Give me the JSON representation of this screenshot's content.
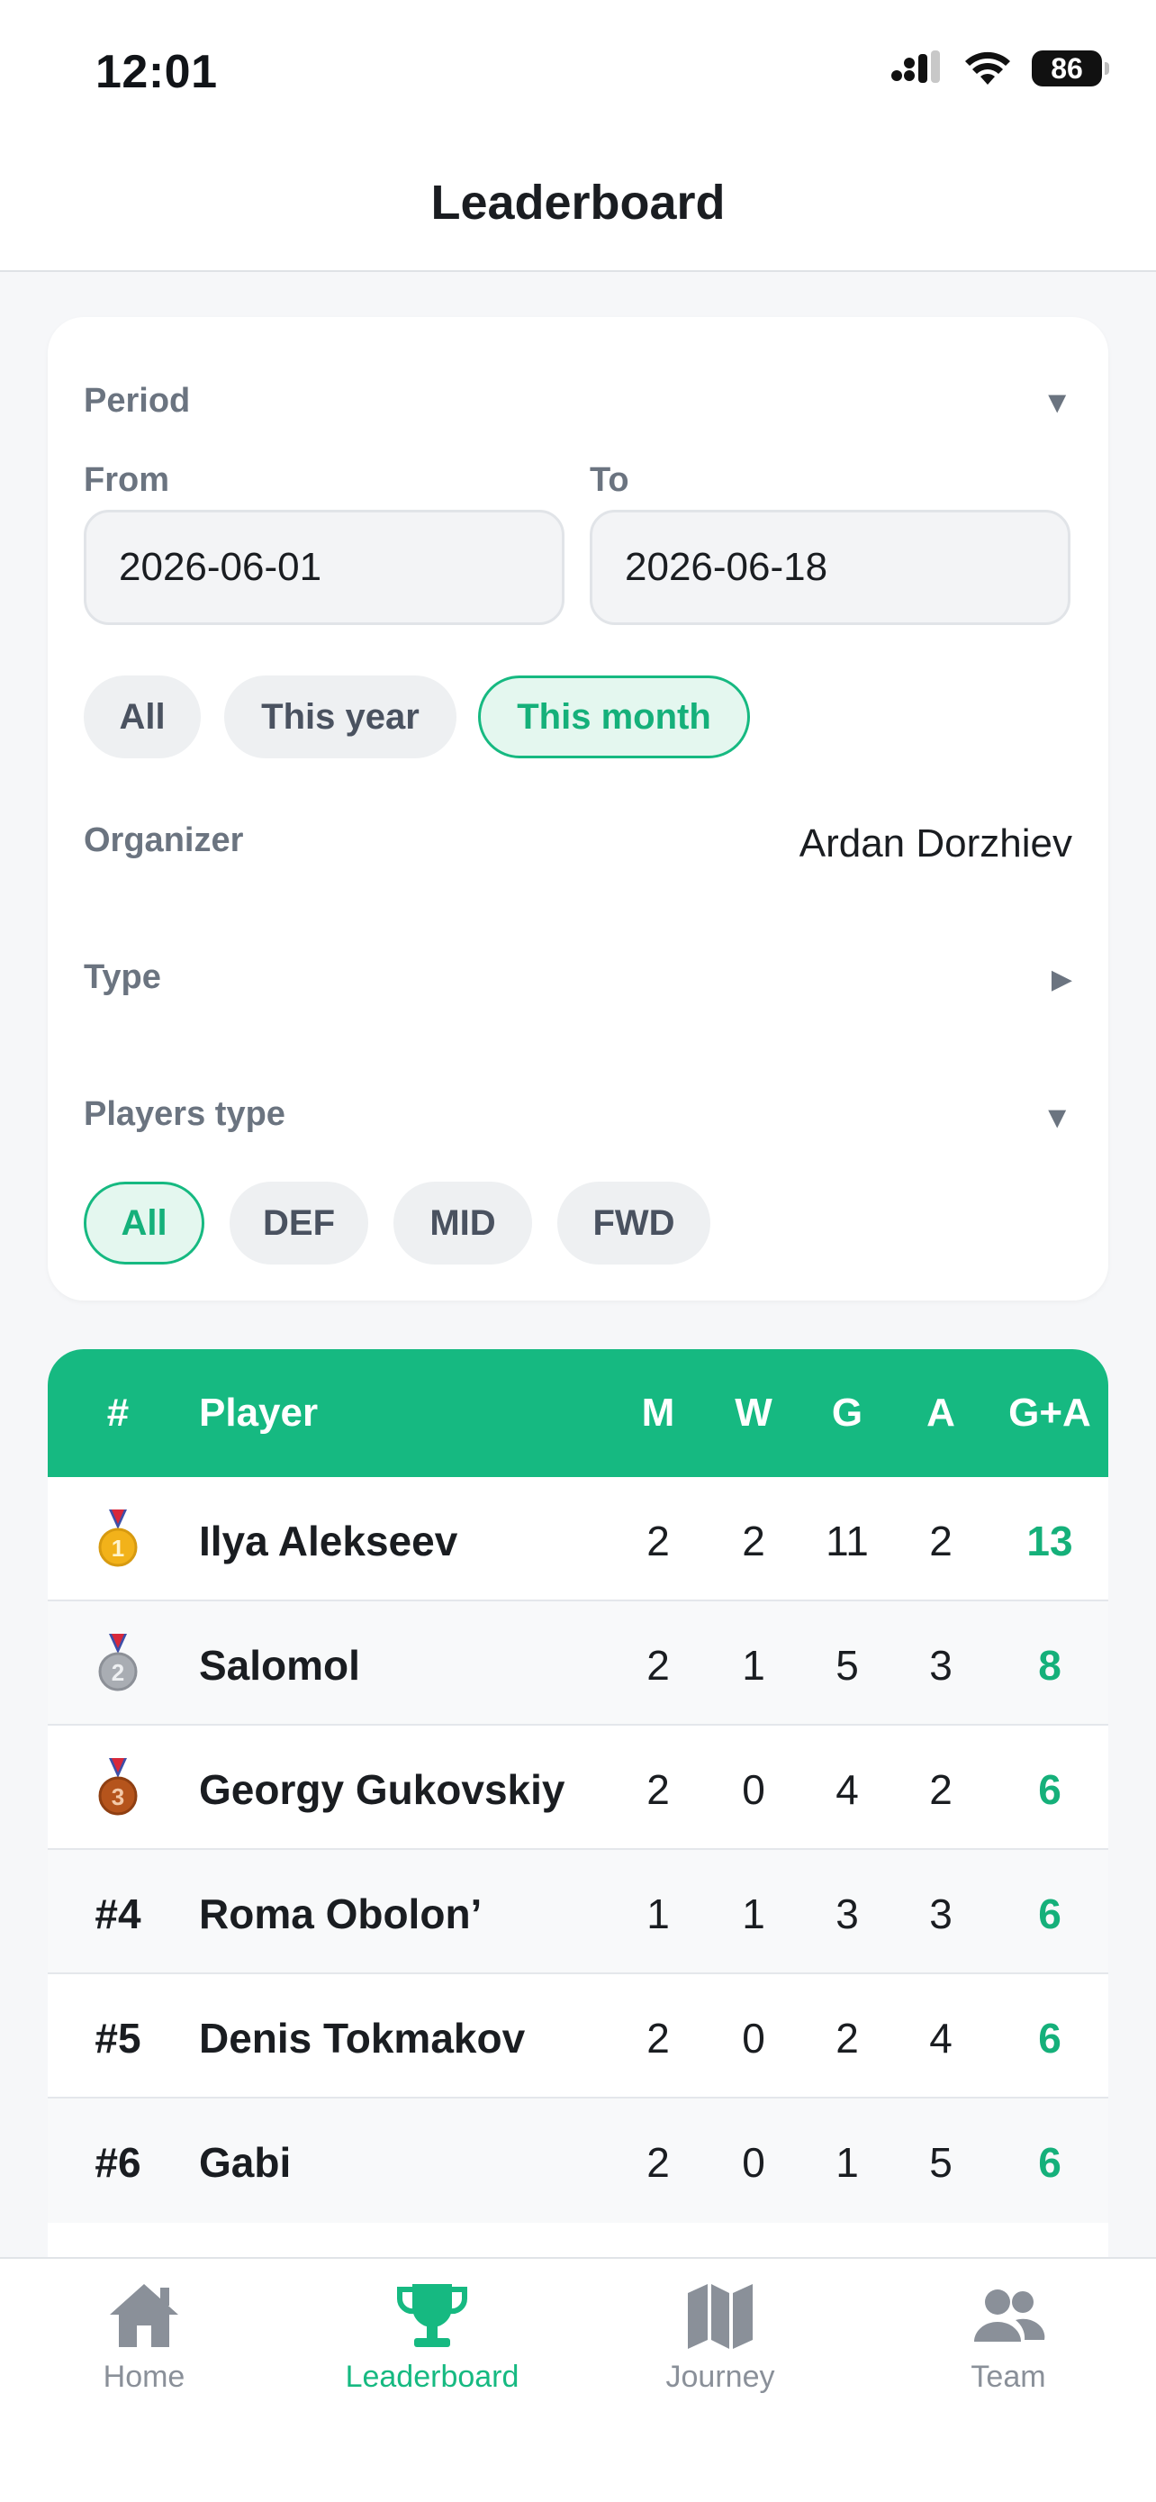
{
  "status_bar": {
    "time": "12:01",
    "battery": "86"
  },
  "header": {
    "title": "Leaderboard"
  },
  "filters": {
    "period_label": "Period",
    "from_label": "From",
    "to_label": "To",
    "from_value": "2026-06-01",
    "to_value": "2026-06-18",
    "period_chips": [
      "All",
      "This year",
      "This month"
    ],
    "period_selected": "This month",
    "organizer_label": "Organizer",
    "organizer_value": "Ardan Dorzhiev",
    "type_label": "Type",
    "players_type_label": "Players type",
    "player_chips": [
      "All",
      "DEF",
      "MID",
      "FWD"
    ],
    "player_selected": "All"
  },
  "table": {
    "headers": {
      "rank": "#",
      "player": "Player",
      "m": "M",
      "w": "W",
      "g": "G",
      "a": "A",
      "ga": "G+A"
    },
    "rows": [
      {
        "rank": "1",
        "medal": "gold",
        "player": "Ilya Alekseev",
        "m": "2",
        "w": "2",
        "g": "11",
        "a": "2",
        "ga": "13"
      },
      {
        "rank": "2",
        "medal": "silver",
        "player": "Salomol",
        "m": "2",
        "w": "1",
        "g": "5",
        "a": "3",
        "ga": "8"
      },
      {
        "rank": "3",
        "medal": "bronze",
        "player": "Georgy Gukovskiy",
        "m": "2",
        "w": "0",
        "g": "4",
        "a": "2",
        "ga": "6"
      },
      {
        "rank": "#4",
        "player": "Roma Obolon’",
        "m": "1",
        "w": "1",
        "g": "3",
        "a": "3",
        "ga": "6"
      },
      {
        "rank": "#5",
        "player": "Denis Tokmakov",
        "m": "2",
        "w": "0",
        "g": "2",
        "a": "4",
        "ga": "6"
      },
      {
        "rank": "#6",
        "player": "Gabi",
        "m": "2",
        "w": "0",
        "g": "1",
        "a": "5",
        "ga": "6"
      }
    ]
  },
  "tabbar": {
    "tabs": [
      {
        "label": "Home",
        "icon": "home-icon"
      },
      {
        "label": "Leaderboard",
        "icon": "trophy-icon"
      },
      {
        "label": "Journey",
        "icon": "map-icon"
      },
      {
        "label": "Team",
        "icon": "team-icon"
      }
    ],
    "active": "Leaderboard"
  },
  "colors": {
    "accent": "#16b981",
    "gold": "#f2b21a",
    "silver": "#a9adb3",
    "bronze": "#b5541c"
  }
}
